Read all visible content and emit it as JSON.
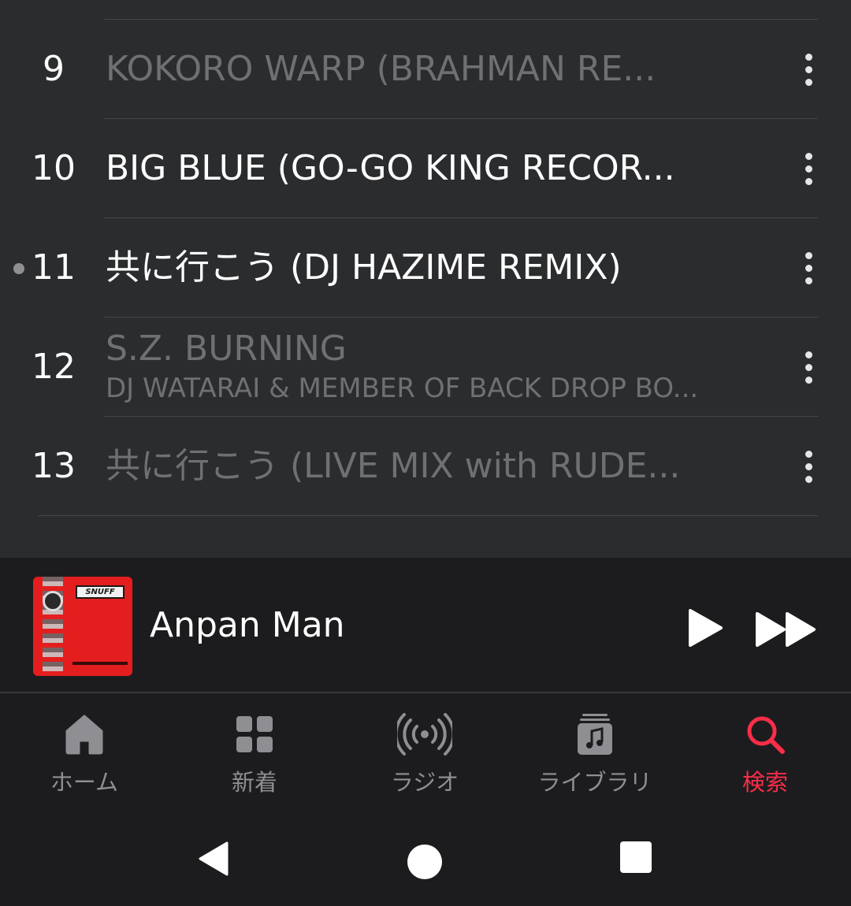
{
  "tracks": [
    {
      "number": "9",
      "title": "KOKORO WARP (BRAHMAN RE...",
      "artist": "",
      "state": "muted"
    },
    {
      "number": "10",
      "title": "BIG BLUE (GO-GO KING RECOR...",
      "artist": "",
      "state": "normal"
    },
    {
      "number": "11",
      "title": "共に行こう (DJ HAZIME REMIX)",
      "artist": "",
      "state": "playing"
    },
    {
      "number": "12",
      "title": "S.Z. BURNING",
      "artist": "DJ WATARAI & MEMBER OF BACK DROP BO...",
      "state": "muted"
    },
    {
      "number": "13",
      "title": "共に行こう (LIVE MIX with RUDE...",
      "artist": "",
      "state": "muted"
    }
  ],
  "mini_player": {
    "title": "Anpan Man",
    "album_art_logo": "SNUFF"
  },
  "tabs": [
    {
      "label": "ホーム",
      "icon": "home-icon",
      "active": false
    },
    {
      "label": "新着",
      "icon": "grid-icon",
      "active": false
    },
    {
      "label": "ラジオ",
      "icon": "radio-icon",
      "active": false
    },
    {
      "label": "ライブラリ",
      "icon": "library-icon",
      "active": false
    },
    {
      "label": "検索",
      "icon": "search-icon",
      "active": true
    }
  ],
  "colors": {
    "accent": "#fa2d48",
    "list_background": "#2b2c2e",
    "bar_background": "#1c1c1e",
    "muted_text": "#6f7072",
    "inactive_tab": "#8e8e93"
  }
}
